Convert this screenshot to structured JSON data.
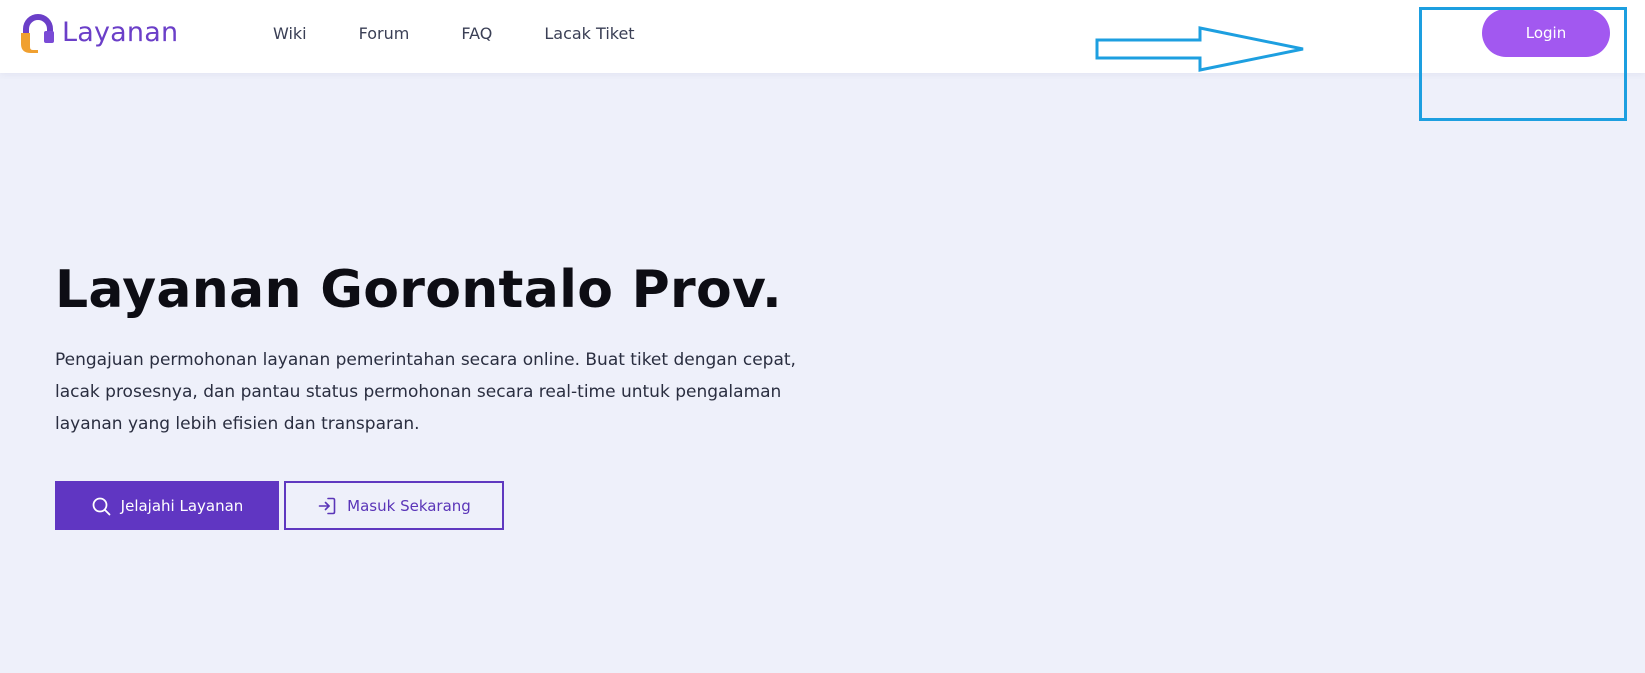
{
  "brand": {
    "name": "Layanan",
    "logo_icon": "headset-logo-icon",
    "accent_color": "#6b3fc8"
  },
  "nav": {
    "links": [
      {
        "label": "Wiki"
      },
      {
        "label": "Forum"
      },
      {
        "label": "FAQ"
      },
      {
        "label": "Lacak Tiket"
      }
    ],
    "login_label": "Login",
    "login_color": "#a258f0"
  },
  "hero": {
    "title": "Layanan Gorontalo Prov.",
    "description": "Pengajuan permohonan layanan pemerintahan secara online. Buat tiket dengan cepat, lacak prosesnya, dan pantau status permohonan secara real-time untuk pengalaman layanan yang lebih efisien dan transparan.",
    "primary_button": {
      "label": "Jelajahi Layanan",
      "icon": "search-icon",
      "color": "#6036c2"
    },
    "secondary_button": {
      "label": "Masuk Sekarang",
      "icon": "login-icon"
    }
  },
  "annotation": {
    "highlight_color": "#1d9fe0",
    "arrow_icon": "right-arrow-icon"
  }
}
